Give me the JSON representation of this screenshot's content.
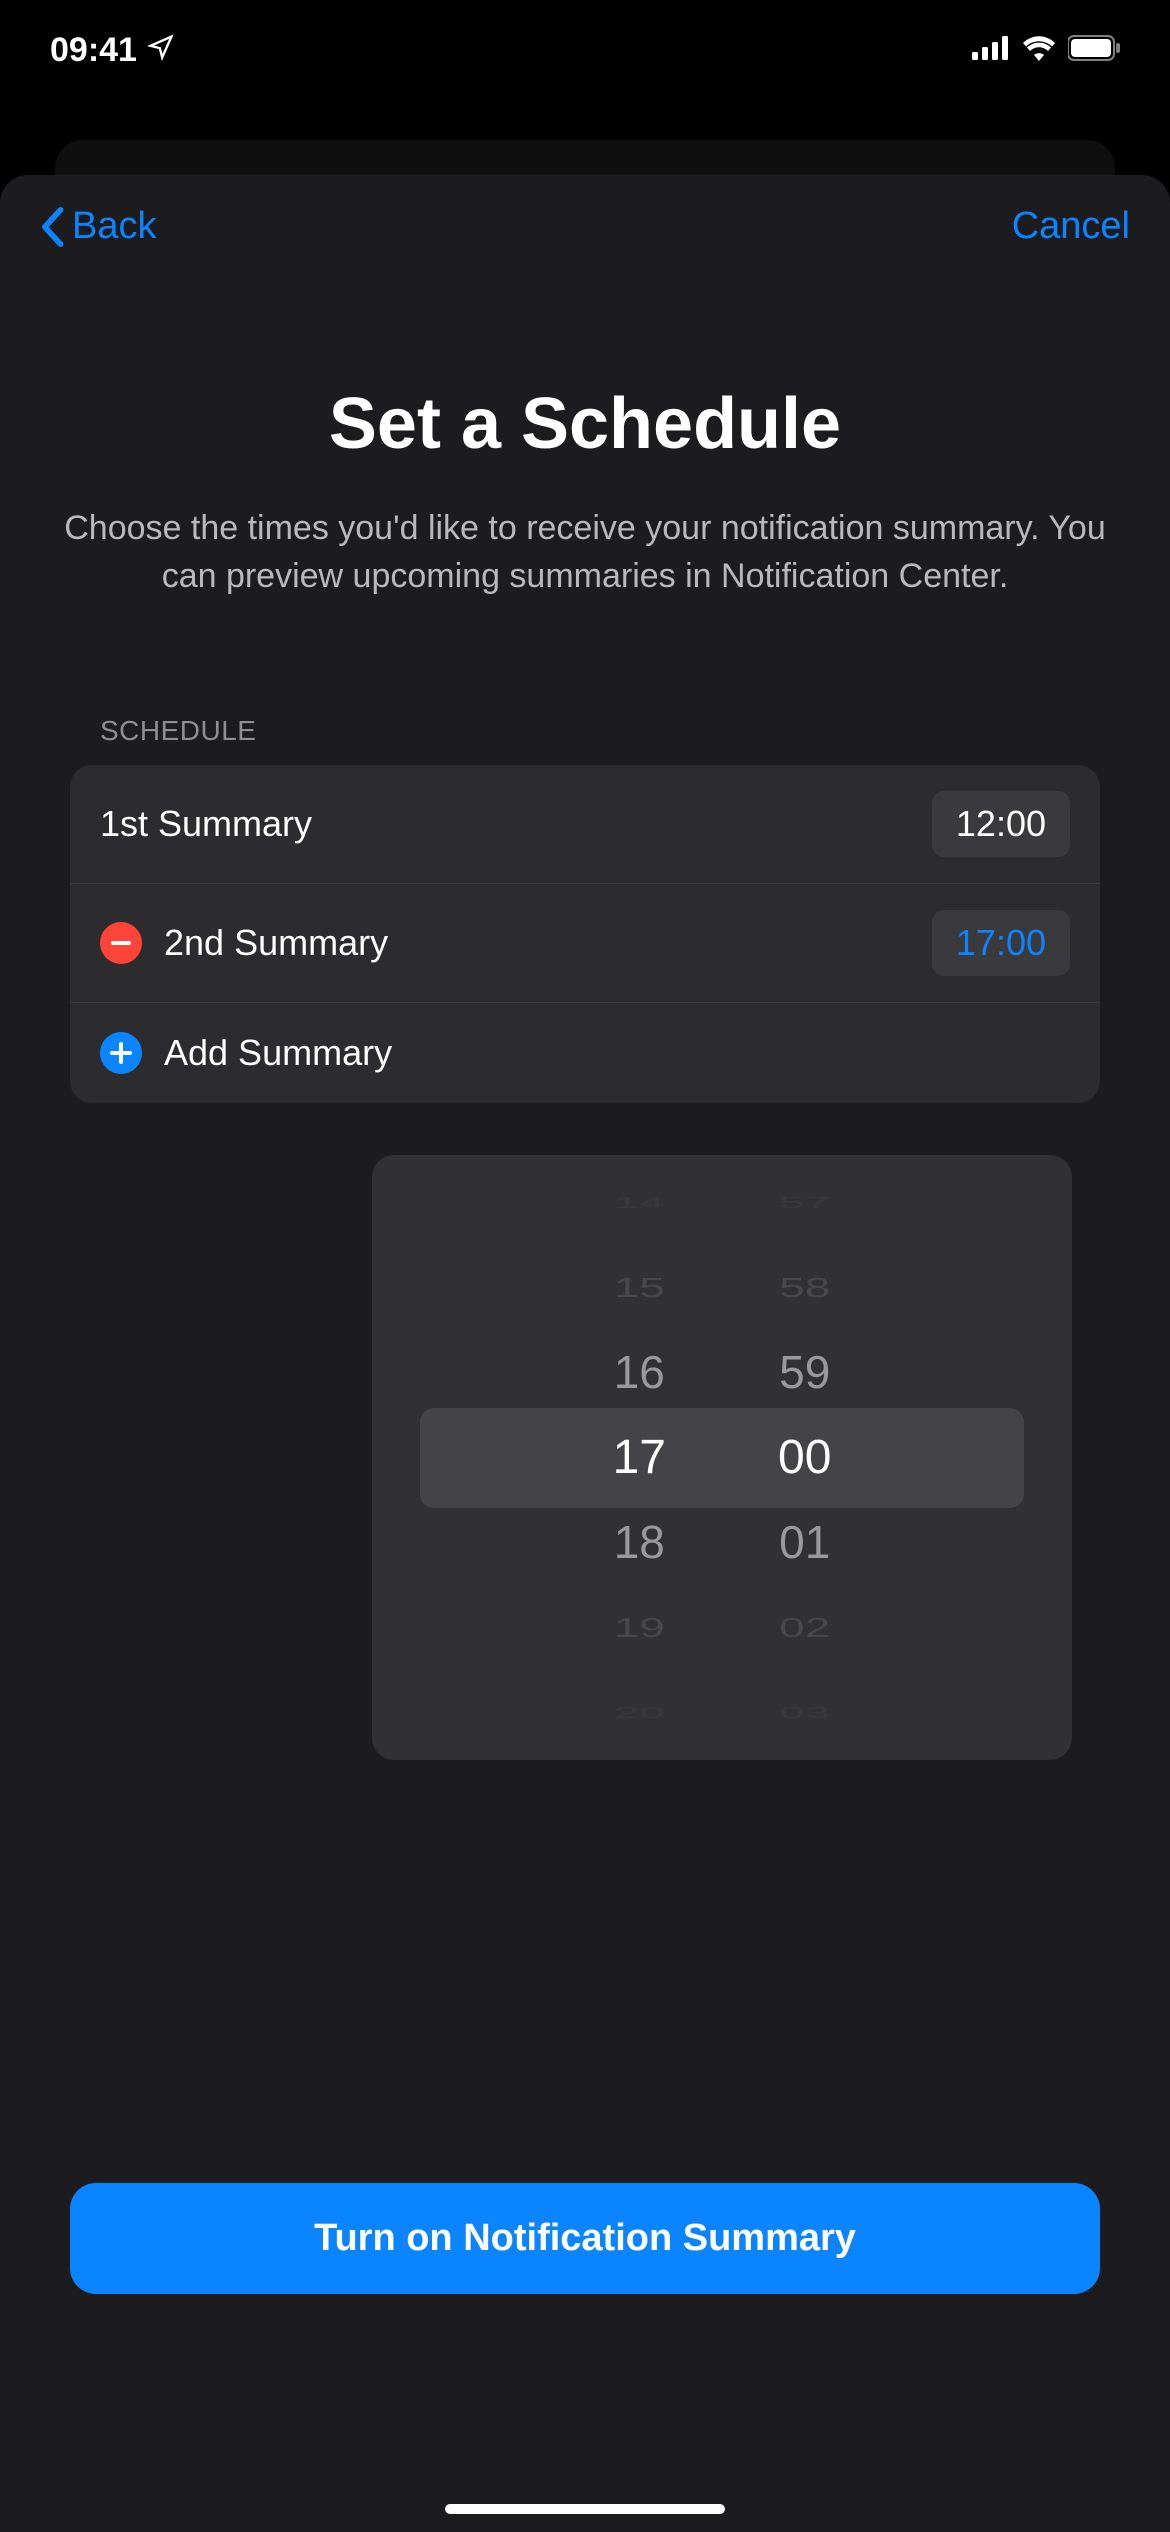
{
  "status": {
    "time": "09:41"
  },
  "nav": {
    "back": "Back",
    "cancel": "Cancel"
  },
  "header": {
    "title": "Set a Schedule",
    "subtitle": "Choose the times you'd like to receive your notification summary. You can preview upcoming summaries in Notification Center."
  },
  "section": {
    "label": "Schedule"
  },
  "rows": {
    "first": {
      "label": "1st Summary",
      "time": "12:00"
    },
    "second": {
      "label": "2nd Summary",
      "time": "17:00"
    },
    "add": {
      "label": "Add Summary"
    }
  },
  "picker": {
    "hours": {
      "p3": "14",
      "p2": "15",
      "p1": "16",
      "sel": "17",
      "n1": "18",
      "n2": "19",
      "n3": "20"
    },
    "minutes": {
      "p3": "57",
      "p2": "58",
      "p1": "59",
      "sel": "00",
      "n1": "01",
      "n2": "02",
      "n3": "03"
    }
  },
  "cta": {
    "label": "Turn on Notification Summary"
  }
}
